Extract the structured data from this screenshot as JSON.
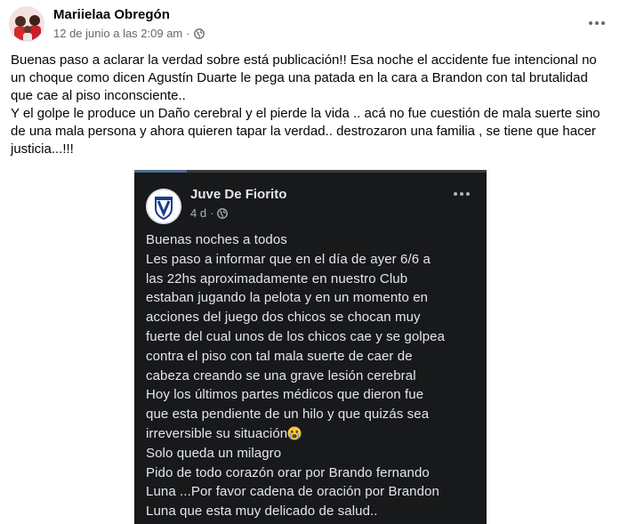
{
  "post": {
    "author": "Mariielaa Obregón",
    "timestamp": "12 de junio a las 2:09 am",
    "separator": "·",
    "text": "Buenas paso a aclarar la verdad sobre está publicación!! Esa noche el accidente fue intencional no un choque como dicen Agustín Duarte le pega una patada en la cara a Brandon con tal brutalidad que cae al piso inconsciente..\nY el golpe le produce un Daño cerebral y el pierde la vida ..  acá no fue cuestión de mala suerte sino de una mala persona y ahora quieren tapar la verdad.. destrozaron una familia , se tiene que hacer justicia...!!!"
  },
  "shared_screenshot": {
    "progress_fraction": 0.15,
    "author": "Juve De Fiorito",
    "time": "4 d",
    "separator": "·",
    "lines": [
      "Buenas noches a todos",
      "Les paso a informar que en el día de ayer 6/6 a",
      "las 22hs aproximadamente en nuestro Club",
      "estaban jugando  la pelota y en un momento en",
      "acciones del juego dos chicos se chocan muy",
      "fuerte del cual unos de los chicos cae y se golpea",
      "contra el piso con tal mala suerte de caer de",
      "cabeza creando se una grave lesión cerebral",
      "Hoy los últimos  partes médicos que dieron fue",
      "que esta pendiente de un hilo y que quizás  sea",
      "irreversible su situación",
      "Solo queda un milagro",
      "Pido de todo corazón orar por Brando fernando",
      "Luna ...Por favor  cadena de oración por Brandon",
      "Luna que esta muy delicado de salud.."
    ]
  },
  "icons": {
    "more": "more-options-icon",
    "globe": "globe-icon",
    "emoji": "crying-face-emoji"
  },
  "colors": {
    "primary_text": "#050505",
    "secondary_text": "#65676b",
    "dark_bg": "#18191a",
    "dark_text": "#e4e6eb"
  }
}
